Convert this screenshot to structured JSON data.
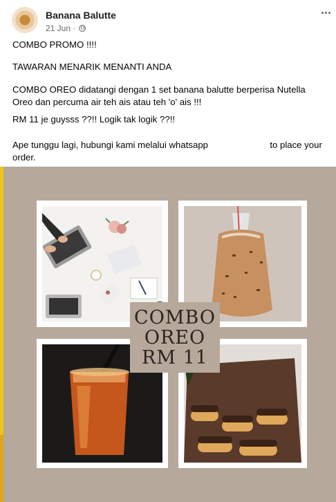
{
  "post": {
    "page_name": "Banana Balutte",
    "date": "21 Jun ·",
    "visibility_icon": "globe-icon",
    "more_icon": "more-icon",
    "lines": {
      "l1": "COMBO PROMO !!!!",
      "l2": "TAWARAN MENARIK MENANTI ANDA",
      "l3": "COMBO OREO didatangi dengan 1 set banana balutte berperisa Nutella",
      "l4": "Oreo dan percuma air teh ais atau teh 'o' ais !!!",
      "l5": "RM 11 je guysss ??!! Logik tak logik ??!!",
      "l6a": "Ape tunggu lagi, hubungi kami melalui whatsapp",
      "l6b": "to place your",
      "l7": "order."
    }
  },
  "image": {
    "overlay_lines": [
      "COMBO",
      "OREO",
      "RM 11"
    ],
    "background_color": "#b6a89b",
    "tiles": [
      "laptop-desk-photo",
      "iced-milk-tea-bag-photo",
      "iced-tea-glass-photo",
      "chocolate-banana-rolls-photo"
    ]
  }
}
